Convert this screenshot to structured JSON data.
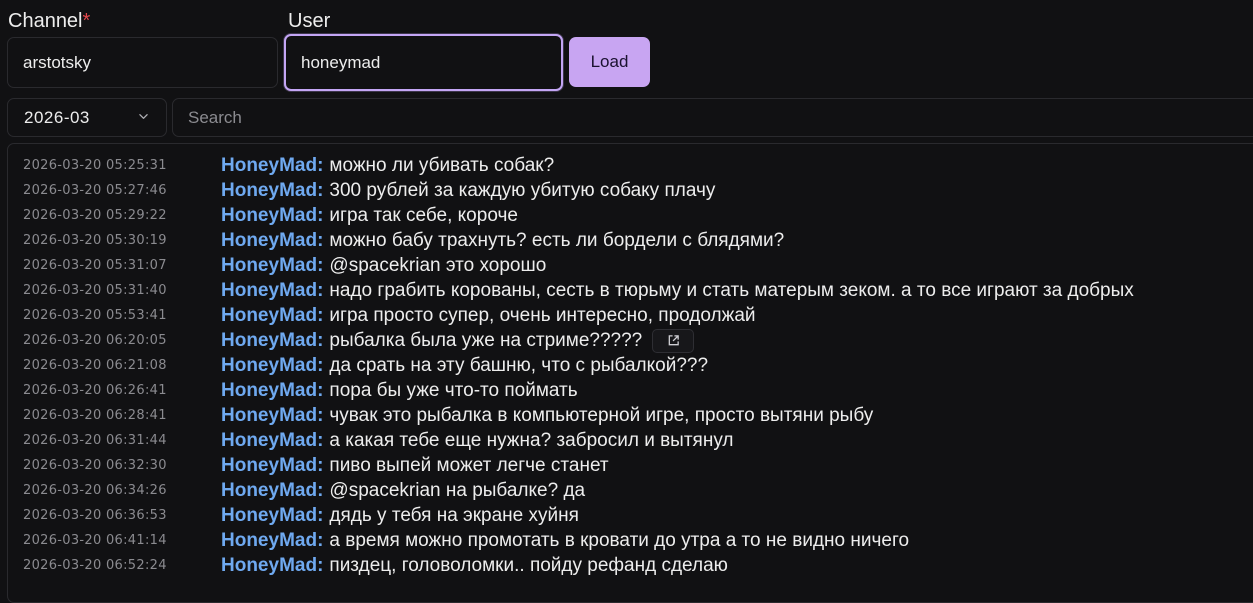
{
  "form": {
    "channel_label": "Channel",
    "required_mark": "*",
    "channel_value": "arstotsky",
    "user_label": "User",
    "user_value": "honeymad",
    "load_label": "Load"
  },
  "filters": {
    "month_value": "2026-03",
    "search_placeholder": "Search"
  },
  "colors": {
    "accent": "#c8a5f2",
    "username": "#6fa9f0",
    "required": "#e5484d"
  },
  "messages": [
    {
      "ts": "2026-03-20 05:25:31",
      "user": "HoneyMad",
      "text": "можно ли убивать собак?"
    },
    {
      "ts": "2026-03-20 05:27:46",
      "user": "HoneyMad",
      "text": "300 рублей за каждую убитую собаку плачу"
    },
    {
      "ts": "2026-03-20 05:29:22",
      "user": "HoneyMad",
      "text": "игра так себе, короче"
    },
    {
      "ts": "2026-03-20 05:30:19",
      "user": "HoneyMad",
      "text": "можно бабу трахнуть? есть ли бордели с блядями?"
    },
    {
      "ts": "2026-03-20 05:31:07",
      "user": "HoneyMad",
      "text": "@spacekrian это хорошо"
    },
    {
      "ts": "2026-03-20 05:31:40",
      "user": "HoneyMad",
      "text": "надо грабить корованы, сесть в тюрьму и стать матерым зеком. а то все играют за добрых"
    },
    {
      "ts": "2026-03-20 05:53:41",
      "user": "HoneyMad",
      "text": "игра просто супер, очень интересно, продолжай"
    },
    {
      "ts": "2026-03-20 06:20:05",
      "user": "HoneyMad",
      "text": "рыбалка была уже на стриме?????",
      "has_link_icon": true
    },
    {
      "ts": "2026-03-20 06:21:08",
      "user": "HoneyMad",
      "text": "да срать на эту башню, что с рыбалкой???"
    },
    {
      "ts": "2026-03-20 06:26:41",
      "user": "HoneyMad",
      "text": "пора бы уже что-то поймать"
    },
    {
      "ts": "2026-03-20 06:28:41",
      "user": "HoneyMad",
      "text": "чувак это рыбалка в компьютерной игре, просто вытяни рыбу"
    },
    {
      "ts": "2026-03-20 06:31:44",
      "user": "HoneyMad",
      "text": "а какая тебе еще нужна? забросил и вытянул"
    },
    {
      "ts": "2026-03-20 06:32:30",
      "user": "HoneyMad",
      "text": "пиво выпей может легче станет"
    },
    {
      "ts": "2026-03-20 06:34:26",
      "user": "HoneyMad",
      "text": "@spacekrian на рыбалке? да"
    },
    {
      "ts": "2026-03-20 06:36:53",
      "user": "HoneyMad",
      "text": "дядь у тебя на экране хуйня"
    },
    {
      "ts": "2026-03-20 06:41:14",
      "user": "HoneyMad",
      "text": "а время можно промотать в кровати до утра а то не видно ничего"
    },
    {
      "ts": "2026-03-20 06:52:24",
      "user": "HoneyMad",
      "text": "пиздец, головоломки.. пойду рефанд сделаю"
    }
  ]
}
